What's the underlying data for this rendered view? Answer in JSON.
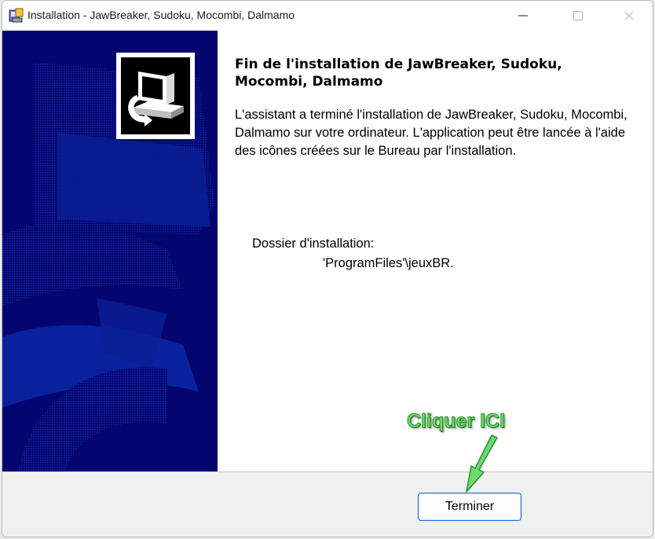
{
  "window": {
    "title": "Installation - JawBreaker, Sudoku, Mocombi, Dalmamo",
    "controls": [
      "minimize-icon",
      "maximize-icon",
      "close-icon"
    ]
  },
  "content": {
    "heading": "Fin de l'installation de JawBreaker, Sudoku, Mocombi, Dalmamo",
    "paragraph": "L'assistant a terminé l'installation de JawBreaker, Sudoku, Mocombi, Dalmamo sur votre ordinateur. L'application peut être lancée à l'aide des icônes créées sur le Bureau par l'installation.",
    "folder_label": "Dossier d'installation:",
    "folder_path": "'ProgramFiles'\\jeuxBR."
  },
  "footer": {
    "finish_label": "Terminer"
  },
  "annotation": {
    "label": "Cliquer ICI",
    "color": "#6fd86f"
  },
  "colors": {
    "side_panel": "#04056f",
    "button_border": "#1f6fd1"
  }
}
